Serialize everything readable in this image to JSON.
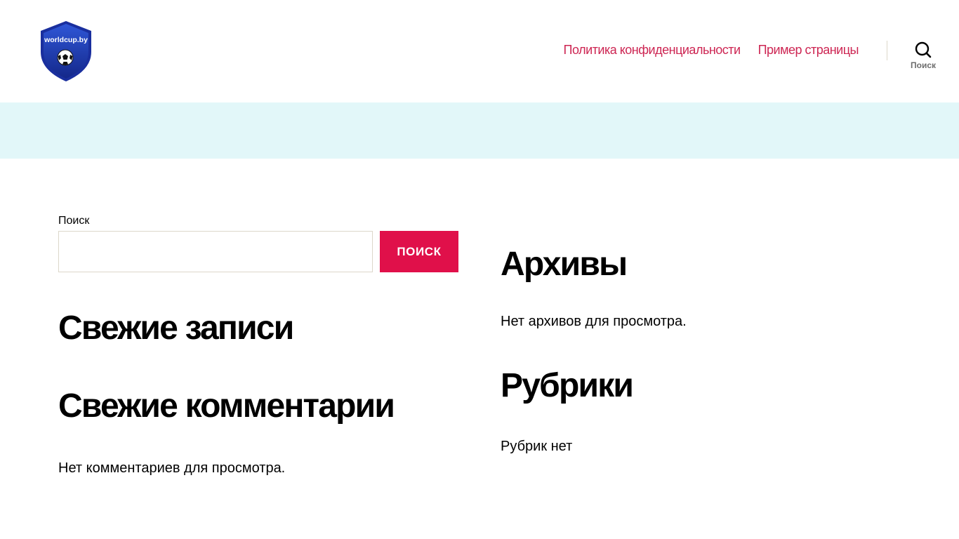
{
  "header": {
    "logo_text": "worldcup.by",
    "nav": [
      {
        "label": "Политика конфиденциальности"
      },
      {
        "label": "Пример страницы"
      }
    ],
    "search_toggle_label": "Поиск",
    "accent_color": "#cd2653"
  },
  "band": {
    "color": "#e2f7f9"
  },
  "widgets": {
    "search": {
      "label": "Поиск",
      "value": "",
      "button_label": "ПОИСК",
      "button_color": "#e0104a"
    },
    "recent_posts": {
      "title": "Свежие записи"
    },
    "recent_comments": {
      "title": "Свежие комментарии",
      "empty_text": "Нет комментариев для просмотра."
    },
    "archives": {
      "title": "Архивы",
      "empty_text": "Нет архивов для просмотра."
    },
    "rubrics": {
      "title": "Рубрики",
      "empty_text": "Рубрик нет"
    }
  },
  "icons": {
    "logo": "shield-soccer-ball-icon",
    "search_toggle": "search-icon"
  }
}
